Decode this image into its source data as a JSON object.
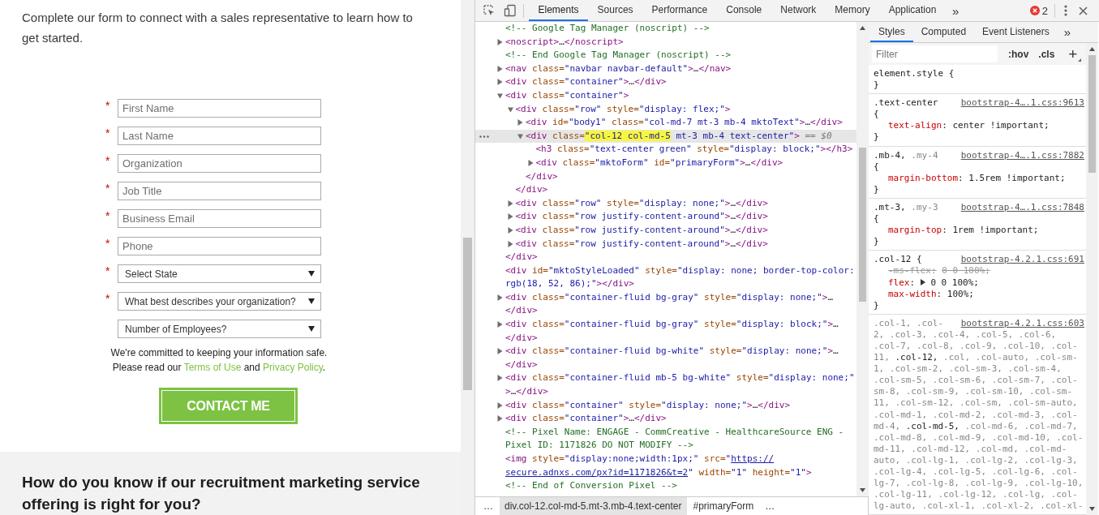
{
  "page": {
    "intro": "Complete our form to connect with a sales representative to learn how to get started.",
    "form": {
      "fields": [
        {
          "kind": "text",
          "placeholder": "First Name",
          "marker": "*"
        },
        {
          "kind": "text",
          "placeholder": "Last Name",
          "marker": "*"
        },
        {
          "kind": "text",
          "placeholder": "Organization",
          "marker": "*"
        },
        {
          "kind": "text",
          "placeholder": "Job Title",
          "marker": "*"
        },
        {
          "kind": "text",
          "placeholder": "Business Email",
          "marker": "*"
        },
        {
          "kind": "text",
          "placeholder": "Phone",
          "marker": "*"
        },
        {
          "kind": "select",
          "value": "Select State",
          "marker": "*"
        },
        {
          "kind": "select",
          "value": "What best describes your organization?",
          "marker": "*"
        },
        {
          "kind": "select",
          "value": "Number of Employees?"
        }
      ],
      "notice": {
        "text": "We're committed to keeping your information safe.",
        "prefix": "Please read our",
        "links": [
          "Terms of Use",
          "Privacy Policy"
        ],
        "joiner": "and",
        "suffix": "."
      },
      "submit": "CONTACT ME"
    },
    "section": {
      "heading": "How do you know if our recruitment marketing service offering is right for you?"
    }
  },
  "devtools": {
    "tabs": [
      {
        "label": "Elements",
        "selected": true
      },
      {
        "label": "Sources",
        "selected": false
      },
      {
        "label": "Performance",
        "selected": false
      },
      {
        "label": "Console",
        "selected": false
      },
      {
        "label": "Network",
        "selected": false
      },
      {
        "label": "Memory",
        "selected": false
      },
      {
        "label": "Application",
        "selected": false
      }
    ],
    "overflow": "»",
    "error_count": "2",
    "dom": [
      {
        "kind": "leaf",
        "selected": false,
        "parts": [
          {
            "kind": "comment",
            "text": "<!-- Google Tag Manager (noscript) -->"
          }
        ]
      },
      {
        "kind": "collapsible",
        "expanded": false,
        "selected": false,
        "parts": [
          {
            "kind": "tag",
            "text": "<noscript>"
          },
          {
            "kind": "text",
            "text": "…"
          },
          {
            "kind": "tag",
            "text": "</noscript>"
          }
        ]
      },
      {
        "kind": "leaf",
        "selected": false,
        "parts": [
          {
            "kind": "comment",
            "text": "<!-- End Google Tag Manager (noscript) -->"
          }
        ]
      },
      {
        "kind": "collapsible",
        "expanded": false,
        "selected": false,
        "parts": [
          {
            "kind": "tag",
            "text": "<nav"
          },
          {
            "kind": "attr",
            "text": " class="
          },
          {
            "kind": "value",
            "text": "\"navbar navbar-default\""
          },
          {
            "kind": "tag",
            "text": ">"
          },
          {
            "kind": "text",
            "text": "…"
          },
          {
            "kind": "tag",
            "text": "</nav>"
          }
        ]
      },
      {
        "kind": "collapsible",
        "expanded": false,
        "selected": false,
        "parts": [
          {
            "kind": "tag",
            "text": "<div"
          },
          {
            "kind": "attr",
            "text": " class="
          },
          {
            "kind": "value",
            "text": "\"container\""
          },
          {
            "kind": "tag",
            "text": ">"
          },
          {
            "kind": "text",
            "text": "…"
          },
          {
            "kind": "tag",
            "text": "</div>"
          }
        ]
      },
      {
        "kind": "collapsible",
        "expanded": true,
        "selected": false,
        "parts": [
          {
            "kind": "tag",
            "text": "<div"
          },
          {
            "kind": "attr",
            "text": " class="
          },
          {
            "kind": "value",
            "text": "\"container\""
          },
          {
            "kind": "tag",
            "text": ">"
          }
        ],
        "close": [
          {
            "kind": "tag",
            "text": "</div>"
          }
        ],
        "children": [
          {
            "kind": "collapsible",
            "expanded": true,
            "selected": false,
            "parts": [
              {
                "kind": "tag",
                "text": "<div"
              },
              {
                "kind": "attr",
                "text": " class="
              },
              {
                "kind": "value",
                "text": "\"row\""
              },
              {
                "kind": "attr",
                "text": " style="
              },
              {
                "kind": "value",
                "text": "\"display: flex;\""
              },
              {
                "kind": "tag",
                "text": ">"
              }
            ],
            "close": [
              {
                "kind": "tag",
                "text": "</div>"
              }
            ],
            "children": [
              {
                "kind": "collapsible",
                "expanded": false,
                "selected": false,
                "parts": [
                  {
                    "kind": "tag",
                    "text": "<div"
                  },
                  {
                    "kind": "attr",
                    "text": " id="
                  },
                  {
                    "kind": "value",
                    "text": "\"body1\""
                  },
                  {
                    "kind": "attr",
                    "text": " class="
                  },
                  {
                    "kind": "value",
                    "text": "\"col-md-7 mt-3 mb-4 mktoText\""
                  },
                  {
                    "kind": "tag",
                    "text": ">"
                  },
                  {
                    "kind": "text",
                    "text": "…"
                  },
                  {
                    "kind": "tag",
                    "text": "</div>"
                  }
                ]
              },
              {
                "kind": "collapsible",
                "expanded": true,
                "selected": true,
                "parts": [
                  {
                    "kind": "tag",
                    "text": "<div"
                  },
                  {
                    "kind": "attr",
                    "text": " class="
                  },
                  {
                    "kind": "highlight",
                    "text": "\"col-12 col-md-5"
                  },
                  {
                    "kind": "value",
                    "text": " mt-3 mb-4 text-center\""
                  },
                  {
                    "kind": "tag",
                    "text": ">"
                  },
                  {
                    "kind": "ref",
                    "text": " == $0"
                  }
                ],
                "close": [
                  {
                    "kind": "tag",
                    "text": "</div>"
                  }
                ],
                "children": [
                  {
                    "kind": "leaf",
                    "selected": false,
                    "parts": [
                      {
                        "kind": "tag",
                        "text": "<h3"
                      },
                      {
                        "kind": "attr",
                        "text": " class="
                      },
                      {
                        "kind": "value",
                        "text": "\"text-center green\""
                      },
                      {
                        "kind": "attr",
                        "text": " style="
                      },
                      {
                        "kind": "value",
                        "text": "\"display: block;\""
                      },
                      {
                        "kind": "tag",
                        "text": "></h3>"
                      }
                    ]
                  },
                  {
                    "kind": "collapsible",
                    "expanded": false,
                    "selected": false,
                    "parts": [
                      {
                        "kind": "tag",
                        "text": "<div"
                      },
                      {
                        "kind": "attr",
                        "text": " class="
                      },
                      {
                        "kind": "value",
                        "text": "\"mktoForm\""
                      },
                      {
                        "kind": "attr",
                        "text": " id="
                      },
                      {
                        "kind": "value",
                        "text": "\"primaryForm\""
                      },
                      {
                        "kind": "tag",
                        "text": ">"
                      },
                      {
                        "kind": "text",
                        "text": "…"
                      },
                      {
                        "kind": "tag",
                        "text": "</div>"
                      }
                    ]
                  }
                ]
              }
            ]
          },
          {
            "kind": "collapsible",
            "expanded": false,
            "selected": false,
            "parts": [
              {
                "kind": "tag",
                "text": "<div"
              },
              {
                "kind": "attr",
                "text": " class="
              },
              {
                "kind": "value",
                "text": "\"row\""
              },
              {
                "kind": "attr",
                "text": " style="
              },
              {
                "kind": "value",
                "text": "\"display: none;\""
              },
              {
                "kind": "tag",
                "text": ">"
              },
              {
                "kind": "text",
                "text": "…"
              },
              {
                "kind": "tag",
                "text": "</div>"
              }
            ]
          },
          {
            "kind": "collapsible",
            "expanded": false,
            "selected": false,
            "parts": [
              {
                "kind": "tag",
                "text": "<div"
              },
              {
                "kind": "attr",
                "text": " class="
              },
              {
                "kind": "value",
                "text": "\"row justify-content-around\""
              },
              {
                "kind": "tag",
                "text": ">"
              },
              {
                "kind": "text",
                "text": "…"
              },
              {
                "kind": "tag",
                "text": "</div>"
              }
            ]
          },
          {
            "kind": "collapsible",
            "expanded": false,
            "selected": false,
            "parts": [
              {
                "kind": "tag",
                "text": "<div"
              },
              {
                "kind": "attr",
                "text": " class="
              },
              {
                "kind": "value",
                "text": "\"row justify-content-around\""
              },
              {
                "kind": "tag",
                "text": ">"
              },
              {
                "kind": "text",
                "text": "…"
              },
              {
                "kind": "tag",
                "text": "</div>"
              }
            ]
          },
          {
            "kind": "collapsible",
            "expanded": false,
            "selected": false,
            "parts": [
              {
                "kind": "tag",
                "text": "<div"
              },
              {
                "kind": "attr",
                "text": " class="
              },
              {
                "kind": "value",
                "text": "\"row justify-content-around\""
              },
              {
                "kind": "tag",
                "text": ">"
              },
              {
                "kind": "text",
                "text": "…"
              },
              {
                "kind": "tag",
                "text": "</div>"
              }
            ]
          }
        ]
      },
      {
        "kind": "leaf",
        "selected": false,
        "parts": [
          {
            "kind": "tag",
            "text": "<div"
          },
          {
            "kind": "attr",
            "text": " id="
          },
          {
            "kind": "value",
            "text": "\"mktoStyleLoaded\""
          },
          {
            "kind": "attr",
            "text": " style="
          },
          {
            "kind": "value",
            "text": "\"display: none; border-top-color: rgb(18, 52, 86);\""
          },
          {
            "kind": "tag",
            "text": "></div>"
          }
        ]
      },
      {
        "kind": "collapsible",
        "expanded": false,
        "selected": false,
        "parts": [
          {
            "kind": "tag",
            "text": "<div"
          },
          {
            "kind": "attr",
            "text": " class="
          },
          {
            "kind": "value",
            "text": "\"container-fluid bg-gray\""
          },
          {
            "kind": "attr",
            "text": " style="
          },
          {
            "kind": "value",
            "text": "\"display: none;\""
          },
          {
            "kind": "tag",
            "text": ">"
          },
          {
            "kind": "text",
            "text": "…"
          },
          {
            "kind": "tag",
            "text": "</div>"
          }
        ]
      },
      {
        "kind": "collapsible",
        "expanded": false,
        "selected": false,
        "parts": [
          {
            "kind": "tag",
            "text": "<div"
          },
          {
            "kind": "attr",
            "text": " class="
          },
          {
            "kind": "value",
            "text": "\"container-fluid bg-gray\""
          },
          {
            "kind": "attr",
            "text": " style="
          },
          {
            "kind": "value",
            "text": "\"display: block;\""
          },
          {
            "kind": "tag",
            "text": ">"
          },
          {
            "kind": "text",
            "text": "…"
          },
          {
            "kind": "tag",
            "text": "</div>"
          }
        ]
      },
      {
        "kind": "collapsible",
        "expanded": false,
        "selected": false,
        "parts": [
          {
            "kind": "tag",
            "text": "<div"
          },
          {
            "kind": "attr",
            "text": " class="
          },
          {
            "kind": "value",
            "text": "\"container-fluid bg-white\""
          },
          {
            "kind": "attr",
            "text": " style="
          },
          {
            "kind": "value",
            "text": "\"display: none;\""
          },
          {
            "kind": "tag",
            "text": ">"
          },
          {
            "kind": "text",
            "text": "…"
          },
          {
            "kind": "tag",
            "text": "</div>"
          }
        ]
      },
      {
        "kind": "collapsible",
        "expanded": false,
        "selected": false,
        "parts": [
          {
            "kind": "tag",
            "text": "<div"
          },
          {
            "kind": "attr",
            "text": " class="
          },
          {
            "kind": "value",
            "text": "\"container-fluid mb-5 bg-white\""
          },
          {
            "kind": "attr",
            "text": " style="
          },
          {
            "kind": "value",
            "text": "\"display: none;"
          },
          {
            "kind": "value",
            "text": "\""
          },
          {
            "kind": "tag",
            "text": ">"
          },
          {
            "kind": "text",
            "text": "…"
          },
          {
            "kind": "tag",
            "text": "</div>"
          }
        ]
      },
      {
        "kind": "collapsible",
        "expanded": false,
        "selected": false,
        "parts": [
          {
            "kind": "tag",
            "text": "<div"
          },
          {
            "kind": "attr",
            "text": " class="
          },
          {
            "kind": "value",
            "text": "\"container\""
          },
          {
            "kind": "attr",
            "text": " style="
          },
          {
            "kind": "value",
            "text": "\"display: none;\""
          },
          {
            "kind": "tag",
            "text": ">"
          },
          {
            "kind": "text",
            "text": "…"
          },
          {
            "kind": "tag",
            "text": "</div>"
          }
        ]
      },
      {
        "kind": "collapsible",
        "expanded": false,
        "selected": false,
        "parts": [
          {
            "kind": "tag",
            "text": "<div"
          },
          {
            "kind": "attr",
            "text": " class="
          },
          {
            "kind": "value",
            "text": "\"container\""
          },
          {
            "kind": "tag",
            "text": ">"
          },
          {
            "kind": "text",
            "text": "…"
          },
          {
            "kind": "tag",
            "text": "</div>"
          }
        ]
      },
      {
        "kind": "leaf",
        "selected": false,
        "parts": [
          {
            "kind": "comment",
            "text": "<!-- Pixel Name: ENGAGE - CommCreative - HealthcareSource ENG - Pixel ID: 1171826 DO NOT MODIFY -->"
          }
        ]
      },
      {
        "kind": "leaf",
        "selected": false,
        "parts": [
          {
            "kind": "tag",
            "text": "<img"
          },
          {
            "kind": "attr",
            "text": " style="
          },
          {
            "kind": "value",
            "text": "\"display:none;width:1px;\""
          },
          {
            "kind": "attr",
            "text": " src="
          },
          {
            "kind": "value",
            "text": "\""
          },
          {
            "kind": "link",
            "text": "https://secure.adnxs.com/px?id=1171826&t=2"
          },
          {
            "kind": "value",
            "text": "\""
          },
          {
            "kind": "attr",
            "text": " width="
          },
          {
            "kind": "value",
            "text": "\"1\""
          },
          {
            "kind": "attr",
            "text": " height="
          },
          {
            "kind": "value",
            "text": "\"1\""
          },
          {
            "kind": "tag",
            "text": ">"
          }
        ]
      },
      {
        "kind": "leaf",
        "selected": false,
        "parts": [
          {
            "kind": "comment",
            "text": "<!-- End of Conversion Pixel -->"
          }
        ]
      }
    ],
    "breadcrumbs": [
      {
        "label": "…",
        "selected": false
      },
      {
        "label": "div.col-12.col-md-5.mt-3.mb-4.text-center",
        "selected": true
      },
      {
        "label": "#primaryForm",
        "selected": false
      },
      {
        "label": "…",
        "selected": false
      }
    ],
    "styles": {
      "tabs": [
        {
          "label": "Styles",
          "selected": true
        },
        {
          "label": "Computed",
          "selected": false
        },
        {
          "label": "Event Listeners",
          "selected": false
        }
      ],
      "overflow": "»",
      "filter": {
        "placeholder": "Filter"
      },
      "toggles": [
        ":hov",
        ".cls"
      ],
      "add": "+",
      "rules": [
        {
          "selectors": [
            {
              "text": "element.style",
              "matched": true
            }
          ],
          "open": "{",
          "close": "}"
        },
        {
          "selectors": [
            {
              "text": ".text-center",
              "matched": true
            }
          ],
          "source": "bootstrap-4….1.css:9613",
          "open": "{",
          "props": [
            {
              "name": "text-align",
              "sep": ":",
              "value": "center !important;",
              "overridden": false,
              "expandable": false
            }
          ],
          "close": "}"
        },
        {
          "selectors": [
            {
              "text": ".mb-4,",
              "matched": true
            },
            {
              "text": " .my-4",
              "matched": false
            }
          ],
          "source": "bootstrap-4….1.css:7882",
          "open": "{",
          "props": [
            {
              "name": "margin-bottom",
              "sep": ":",
              "value": "1.5rem !important;",
              "overridden": false,
              "expandable": false
            }
          ],
          "close": "}"
        },
        {
          "selectors": [
            {
              "text": ".mt-3,",
              "matched": true
            },
            {
              "text": " .my-3",
              "matched": false
            }
          ],
          "source": "bootstrap-4….1.css:7848",
          "open": "{",
          "props": [
            {
              "name": "margin-top",
              "sep": ":",
              "value": "1rem !important;",
              "overridden": false,
              "expandable": false
            }
          ],
          "close": "}"
        },
        {
          "selectors": [
            {
              "text": ".col-12",
              "matched": true
            }
          ],
          "source": "bootstrap-4.2.1.css:691",
          "open": "{",
          "props": [
            {
              "name": "-ms-flex",
              "sep": ":",
              "value": "0 0 100%;",
              "overridden": true,
              "expandable": false
            },
            {
              "name": "flex",
              "sep": ":",
              "value": "0 0 100%;",
              "overridden": false,
              "expandable": true
            },
            {
              "name": "max-width",
              "sep": ":",
              "value": "100%;",
              "overridden": false,
              "expandable": false
            }
          ],
          "close": "}"
        },
        {
          "selectors": [
            {
              "text": ".col-1, .col-2, .col-3, .col-4, .col-5, .col-6, .col-7, .col-8, .col-9, .col-10, .col-11, ",
              "matched": false
            },
            {
              "text": ".col-12,",
              "matched": true
            },
            {
              "text": " .col, .col-auto, .col-sm-1, .col-sm-2, .col-sm-3, .col-sm-4, .col-sm-5, .col-sm-6, .col-sm-7, .col-sm-8, .col-sm-9, .col-sm-10, .col-sm-11, .col-sm-12, .col-sm, .col-sm-auto, .col-md-1, .col-md-2, .col-md-3, .col-md-4, ",
              "matched": false
            },
            {
              "text": ".col-md-5,",
              "matched": true
            },
            {
              "text": " .col-md-6, .col-md-7, .col-md-8, .col-md-9, .col-md-10, .col-md-11, .col-md-12, .col-md, .col-md-auto, .col-lg-1, .col-lg-2, .col-lg-3, .col-lg-4, .col-lg-5, .col-lg-6, .col-lg-7, .col-lg-8, .col-lg-9, .col-lg-10, .col-lg-11, .col-lg-12, .col-lg, .col-lg-auto, .col-xl-1, .col-xl-2, .col-xl-",
              "matched": false
            }
          ],
          "source": "bootstrap-4.2.1.css:603"
        }
      ]
    }
  }
}
